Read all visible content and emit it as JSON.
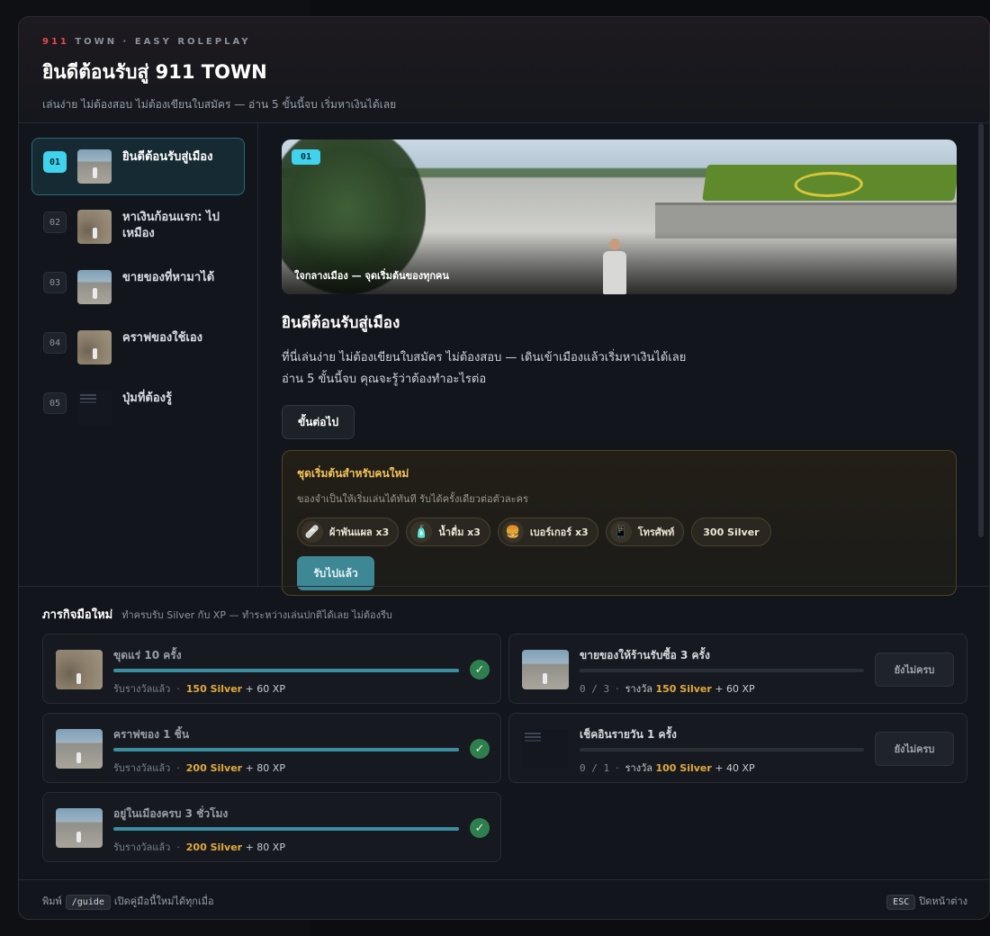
{
  "header": {
    "eyebrow_num": "911",
    "eyebrow_rest": " TOWN · EASY ROLEPLAY",
    "title": "ยินดีต้อนรับสู่ 911 TOWN",
    "subtitle": "เล่นง่าย ไม่ต้องสอบ ไม่ต้องเขียนใบสมัคร — อ่าน 5 ขั้นนี้จบ เริ่มหาเงินได้เลย"
  },
  "sidebar": {
    "items": [
      {
        "num": "01",
        "label": "ยินดีต้อนรับสู่เมือง",
        "active": true
      },
      {
        "num": "02",
        "label": "หาเงินก้อนแรก: ไปเหมือง",
        "active": false
      },
      {
        "num": "03",
        "label": "ขายของที่หามาได้",
        "active": false
      },
      {
        "num": "04",
        "label": "คราฟของใช้เอง",
        "active": false
      },
      {
        "num": "05",
        "label": "ปุ่มที่ต้องรู้",
        "active": false
      }
    ]
  },
  "main": {
    "hero_badge": "01",
    "hero_caption": "ใจกลางเมือง — จุดเริ่มต้นของทุกคน",
    "heading": "ยินดีต้อนรับสู่เมือง",
    "para_line1": "ที่นี่เล่นง่าย ไม่ต้องเขียนใบสมัคร ไม่ต้องสอบ — เดินเข้าเมืองแล้วเริ่มหาเงินได้เลย",
    "para_line2": "อ่าน 5 ขั้นนี้จบ คุณจะรู้ว่าต้องทำอะไรต่อ",
    "next_button": "ขั้นต่อไป"
  },
  "starter_kit": {
    "title": "ชุดเริ่มต้นสำหรับคนใหม่",
    "subtitle": "ของจำเป็นให้เริ่มเล่นได้ทันที รับได้ครั้งเดียวต่อตัวละคร",
    "items": [
      {
        "label": "ผ้าพันแผล x3",
        "icon": "bandage-icon"
      },
      {
        "label": "น้ำดื่ม x3",
        "icon": "water-bottle-icon"
      },
      {
        "label": "เบอร์เกอร์ x3",
        "icon": "burger-icon"
      },
      {
        "label": "โทรศัพท์",
        "icon": "phone-icon"
      },
      {
        "label": "300 Silver",
        "icon": ""
      }
    ],
    "claim_button": "รับไปแล้ว"
  },
  "quests": {
    "title": "ภารกิจมือใหม่",
    "subtitle": "ทำครบรับ Silver กับ XP — ทำระหว่างเล่นปกติได้เลย ไม่ต้องรีบ",
    "left": [
      {
        "name": "ขุดแร่ 10 ครั้ง",
        "status": "รับรางวัลแล้ว",
        "sep": "·",
        "silver": "150 Silver",
        "xp": "+ 60 XP",
        "progress": 1.0
      },
      {
        "name": "คราฟของ 1 ชิ้น",
        "status": "รับรางวัลแล้ว",
        "sep": "·",
        "silver": "200 Silver",
        "xp": "+ 80 XP",
        "progress": 1.0
      },
      {
        "name": "อยู่ในเมืองครบ 3 ชั่วโมง",
        "status": "รับรางวัลแล้ว",
        "sep": "·",
        "silver": "200 Silver",
        "xp": "+ 80 XP",
        "progress": 1.0
      }
    ],
    "right": [
      {
        "name": "ขายของให้ร้านรับซื้อ 3 ครั้ง",
        "count": "0 / 3",
        "sep": "·",
        "reward_label": "รางวัล",
        "silver": "150 Silver",
        "xp": "+ 60 XP",
        "button": "ยังไม่ครบ",
        "progress": 0.0
      },
      {
        "name": "เช็คอินรายวัน 1 ครั้ง",
        "count": "0 / 1",
        "sep": "·",
        "reward_label": "รางวัล",
        "silver": "100 Silver",
        "xp": "+ 40 XP",
        "button": "ยังไม่ครบ",
        "progress": 0.0
      }
    ]
  },
  "footer": {
    "left_prefix": "พิมพ์",
    "command": "/guide",
    "left_suffix": "เปิดคู่มือนี้ใหม่ได้ทุกเมื่อ",
    "esc_key": "ESC",
    "right_text": "ปิดหน้าต่าง"
  },
  "colors": {
    "accent": "#3fd3ee",
    "gold": "#e2a93c",
    "kit_title": "#f3c55a",
    "success": "#2f7f4e",
    "eyebrow_red": "#e34a4a"
  }
}
